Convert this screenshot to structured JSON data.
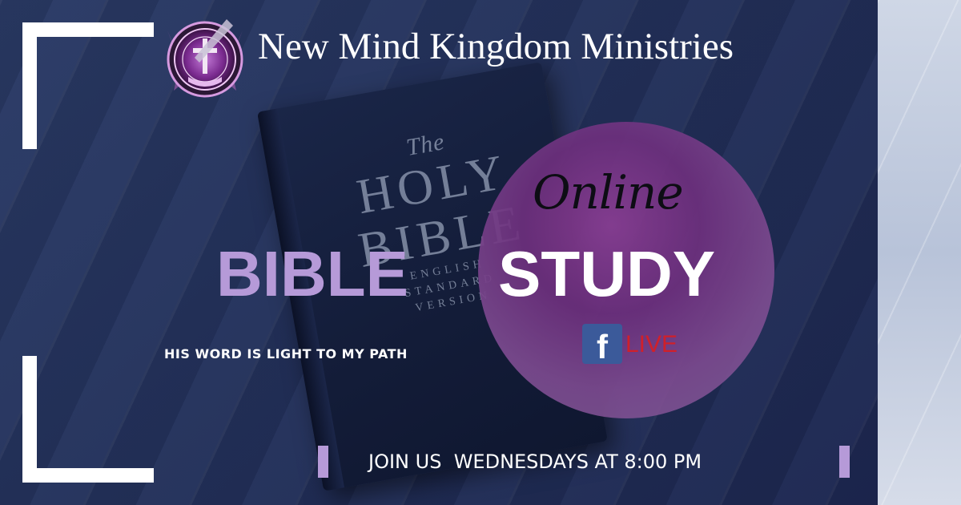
{
  "header": {
    "org_name": "New Mind Kingdom Ministries"
  },
  "book": {
    "the": "The",
    "holy": "HOLY",
    "bible": "BIBLE",
    "sub1": "ENGLISH",
    "sub2": "STANDARD",
    "sub3": "VERSION"
  },
  "headline": {
    "online": "Online",
    "bible": "BIBLE",
    "study": "STUDY"
  },
  "tagline": "HIS WORD IS LIGHT TO MY PATH",
  "facebook": {
    "f": "f",
    "live": "LIVE"
  },
  "schedule": "JOIN US  WEDNESDAYS AT 8:00 PM",
  "colors": {
    "background": "#24325c",
    "accent_lavender": "#b69ad8",
    "circle_purple": "#6d2f7d",
    "live_red": "#d0202a",
    "facebook_blue": "#3b5a9a"
  },
  "icons": [
    "ministry-seal-logo",
    "facebook-icon"
  ]
}
